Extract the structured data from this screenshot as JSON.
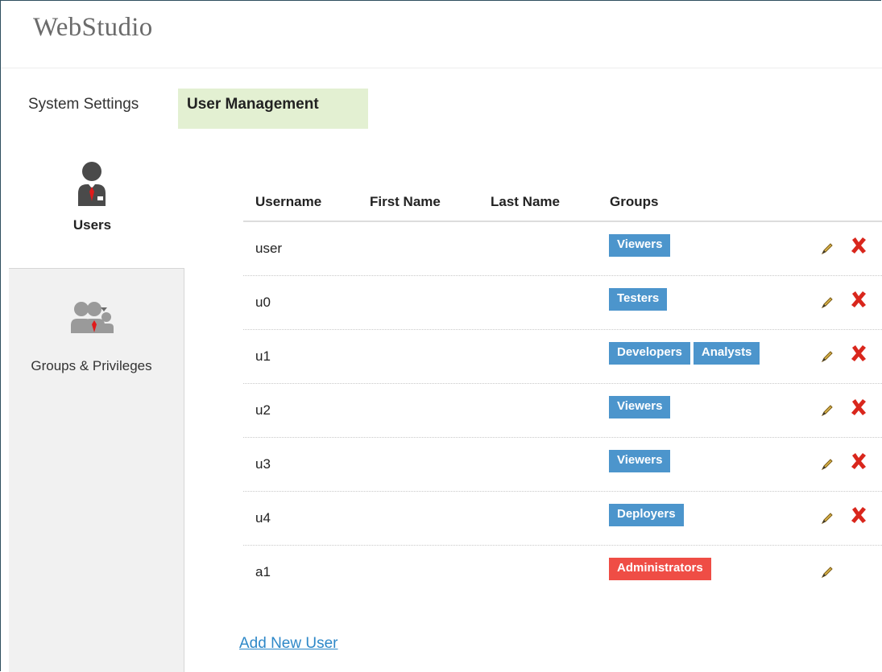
{
  "app": {
    "title": "WebStudio"
  },
  "top_tabs": [
    {
      "label": "System Settings",
      "active": false
    },
    {
      "label": "User Management",
      "active": true
    }
  ],
  "sidebar": {
    "items": [
      {
        "label": "Users",
        "icon": "user-icon",
        "active": true
      },
      {
        "label": "Groups & Privileges",
        "icon": "groups-icon",
        "active": false
      }
    ]
  },
  "table": {
    "columns": [
      "Username",
      "First Name",
      "Last Name",
      "Groups"
    ],
    "rows": [
      {
        "username": "user",
        "first_name": "",
        "last_name": "",
        "groups": [
          "Viewers"
        ],
        "deletable": true
      },
      {
        "username": "u0",
        "first_name": "",
        "last_name": "",
        "groups": [
          "Testers"
        ],
        "deletable": true
      },
      {
        "username": "u1",
        "first_name": "",
        "last_name": "",
        "groups": [
          "Developers",
          "Analysts"
        ],
        "deletable": true
      },
      {
        "username": "u2",
        "first_name": "",
        "last_name": "",
        "groups": [
          "Viewers"
        ],
        "deletable": true
      },
      {
        "username": "u3",
        "first_name": "",
        "last_name": "",
        "groups": [
          "Viewers"
        ],
        "deletable": true
      },
      {
        "username": "u4",
        "first_name": "",
        "last_name": "",
        "groups": [
          "Deployers"
        ],
        "deletable": true
      },
      {
        "username": "a1",
        "first_name": "",
        "last_name": "",
        "groups": [
          "Administrators"
        ],
        "deletable": false
      }
    ]
  },
  "actions": {
    "add_user": "Add New User"
  },
  "colors": {
    "active_tab_bg": "#e3f0d2",
    "group_badge": "#4c95cc",
    "admin_badge": "#ef4d45",
    "delete_red": "#d9261c",
    "link": "#2e88c8"
  }
}
